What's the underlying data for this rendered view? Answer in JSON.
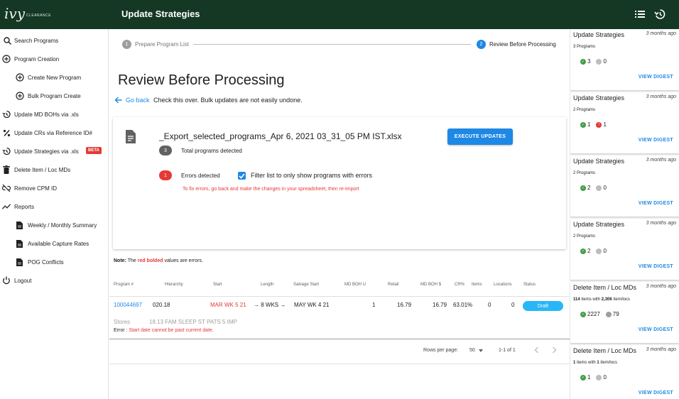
{
  "header": {
    "logo_text": "ivy",
    "logo_sub": "CLEARANCE",
    "title": "Update Strategies"
  },
  "sidebar": {
    "items": [
      {
        "label": "Search Programs",
        "icon": "search-icon"
      },
      {
        "label": "Program Creation",
        "icon": "add-circle-icon"
      },
      {
        "label": "Create New Program",
        "icon": "add-circle-icon"
      },
      {
        "label": "Bulk Program Create",
        "icon": "add-circle-icon"
      },
      {
        "label": "Update MD BOHs via .xls",
        "icon": "history-icon"
      },
      {
        "label": "Update CRs via Reference ID#",
        "icon": "percent-icon"
      },
      {
        "label": "Update Strategies via .xls",
        "icon": "history-icon",
        "badge": "BETA"
      },
      {
        "label": "Delete Item / Loc MDs",
        "icon": "trash-icon"
      },
      {
        "label": "Remove CPM ID",
        "icon": "link-off-icon"
      },
      {
        "label": "Reports",
        "icon": "trending-icon"
      },
      {
        "label": "Weekly / Monthly Summary",
        "icon": "document-icon"
      },
      {
        "label": "Available Capture Rates",
        "icon": "document-icon"
      },
      {
        "label": "POG Conflicts",
        "icon": "document-icon"
      },
      {
        "label": "Logout",
        "icon": "power-icon"
      }
    ]
  },
  "stepper": {
    "step1_num": "1",
    "step1_label": "Prepare Program List",
    "step2_num": "2",
    "step2_label": "Review Before Processing"
  },
  "main": {
    "heading": "Review Before Processing",
    "go_back": "Go back",
    "go_back_hint": "Check this over. Bulk updates are not easily undone.",
    "file_name": "_Export_selected_programs_Apr 6, 2021 03_31_05 PM IST.xlsx",
    "execute_label": "EXECUTE UPDATES",
    "total_count": "3",
    "total_label": "Total programs detected",
    "error_count": "1",
    "error_label": "Errors detected",
    "filter_label": "Filter list to only show programs with errors",
    "error_hint": "To fix errors, go back and make the changes in your spreadsheet, then re-import",
    "note_prefix": "Note:",
    "note_mid": " The ",
    "note_red": "red bolded",
    "note_suffix": " values are errors."
  },
  "table": {
    "headers": [
      "Program #",
      "Hierarchy",
      "Start",
      "Length",
      "Salvage Start",
      "MD BOH U",
      "Retail",
      "MD BOH $",
      "CR%",
      "Items",
      "Locations",
      "Status"
    ],
    "row": {
      "program": "100044697",
      "hierarchy": "020.18",
      "start": "MAR WK 5 21",
      "length": "8 WKS",
      "salvage": "MAY WK 4 21",
      "md_boh_u": "1",
      "retail": "16.79",
      "md_boh_d": "16.79",
      "cr": "63.01%",
      "items": "0",
      "locations": "0",
      "status": "Draft"
    },
    "stores_label": "Stores",
    "stores_value": "18.13 FAM SLEEP ST PATS 5 IMP",
    "error_prefix": "Error :",
    "error_msg": " Start date cannot be past current date."
  },
  "pager": {
    "rows_label": "Rows per page:",
    "rows_value": "50",
    "range": "1-1 of 1"
  },
  "digests": [
    {
      "title": "Update Strategies",
      "time": "3 months ago",
      "sub_plain": "3 Programs",
      "ok": "3",
      "err": null,
      "pending": "0",
      "link": "VIEW DIGEST"
    },
    {
      "title": "Update Strategies",
      "time": "3 months ago",
      "sub_plain": "2 Programs",
      "ok": "1",
      "err": "1",
      "pending": null,
      "link": "VIEW DIGEST"
    },
    {
      "title": "Update Strategies",
      "time": "3 months ago",
      "sub_plain": "2 Programs",
      "ok": "2",
      "err": null,
      "pending": "0",
      "link": "VIEW DIGEST"
    },
    {
      "title": "Update Strategies",
      "time": "3 months ago",
      "sub_plain": "2 Programs",
      "ok": "2",
      "err": null,
      "pending": "0",
      "link": "VIEW DIGEST"
    },
    {
      "title": "Delete Item / Loc MDs",
      "time": "3 months ago",
      "sub_a": "114",
      "sub_b": " items with ",
      "sub_c": "2,306",
      "sub_d": " item/locs",
      "ok": "2227",
      "err": null,
      "pending": "79",
      "link": "VIEW DIGEST"
    },
    {
      "title": "Delete Item / Loc MDs",
      "time": "3 months ago",
      "sub_a": "1",
      "sub_b": " items with ",
      "sub_c": "1",
      "sub_d": " item/locs",
      "ok": "1",
      "err": null,
      "pending": "0",
      "link": "VIEW DIGEST"
    }
  ],
  "colors": {
    "brand": "#143824",
    "accent": "#1e88e5",
    "error": "#e53935",
    "success": "#43a047",
    "draft": "#29b6f6"
  }
}
